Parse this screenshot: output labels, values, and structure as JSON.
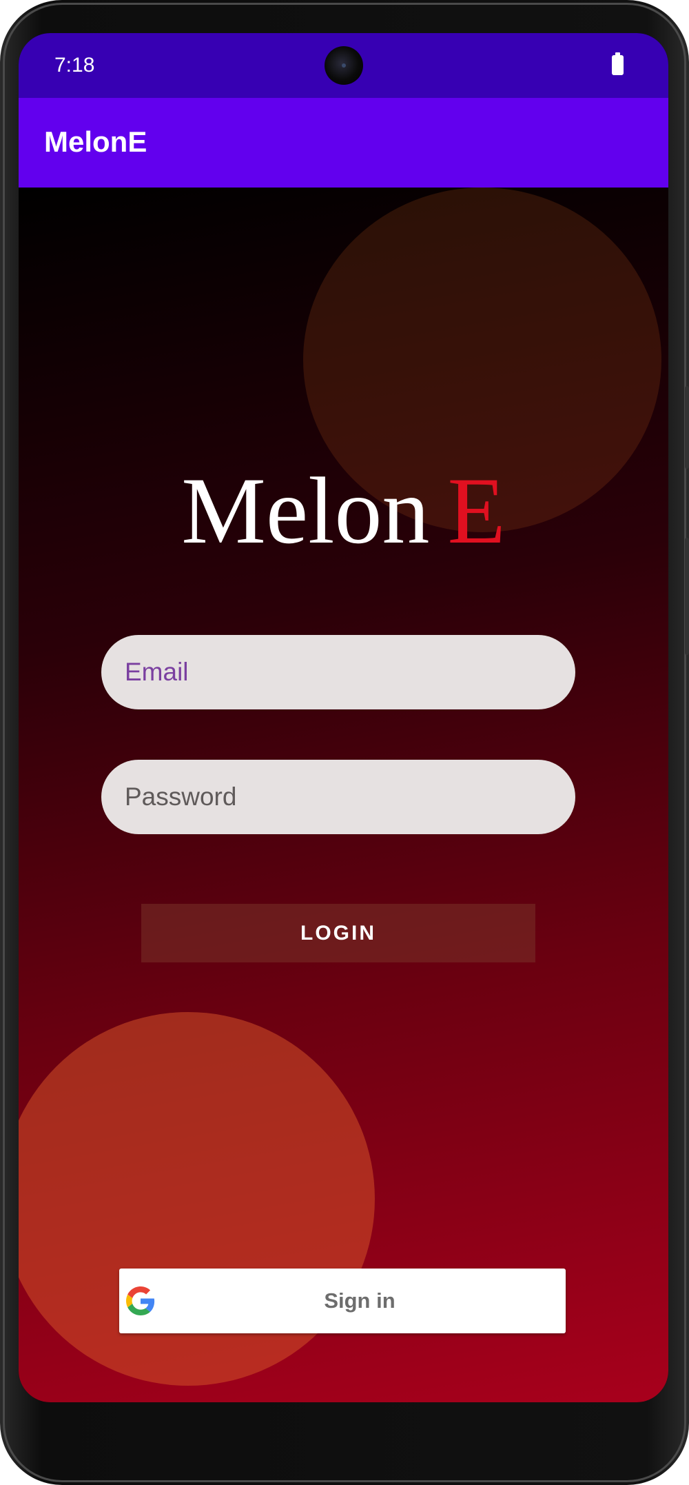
{
  "status_bar": {
    "time": "7:18",
    "battery_icon": "battery-full-icon"
  },
  "app_bar": {
    "title": "MelonE"
  },
  "logo": {
    "text_main": "Melon",
    "text_accent": "E",
    "accent_color": "#e01020"
  },
  "form": {
    "email_placeholder": "Email",
    "password_placeholder": "Password",
    "login_label": "LOGIN"
  },
  "google_signin": {
    "icon": "google-icon",
    "label": "Sign in"
  },
  "colors": {
    "status_bar": "#3700b3",
    "app_bar": "#6200ee",
    "field_bg": "#e6e1e1"
  }
}
